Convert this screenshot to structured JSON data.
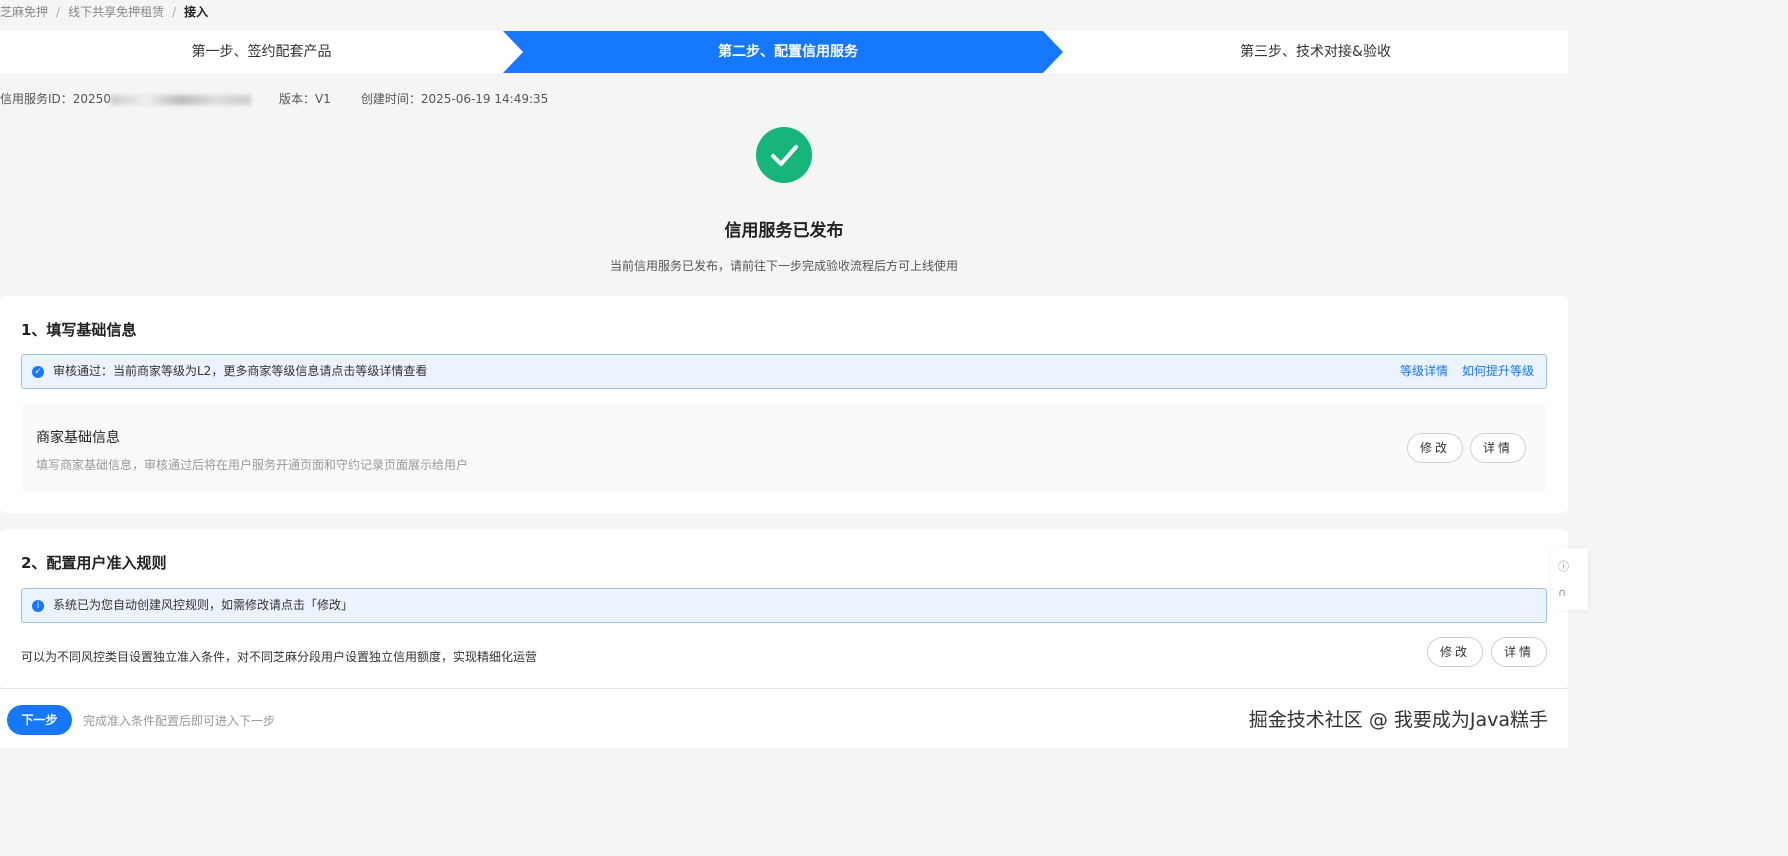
{
  "breadcrumb": [
    "芝麻免押",
    "线下共享免押租赁",
    "接入"
  ],
  "steps": [
    "第一步、签约配套产品",
    "第二步、配置信用服务",
    "第三步、技术对接&验收"
  ],
  "meta": {
    "id_label": "信用服务ID：",
    "id_value": "20250",
    "version": "版本：V1",
    "created": "创建时间：2025-06-19 14:49:35"
  },
  "result": {
    "title": "信用服务已发布",
    "subtitle": "当前信用服务已发布，请前往下一步完成验收流程后方可上线使用"
  },
  "section1": {
    "title": "1、填写基础信息",
    "alert": "审核通过：当前商家等级为L2，更多商家等级信息请点击等级详情查看",
    "link1": "等级详情",
    "link2": "如何提升等级",
    "item_title": "商家基础信息",
    "item_desc": "填写商家基础信息，审核通过后将在用户服务开通页面和守约记录页面展示给用户",
    "edit": "修改",
    "detail": "详情"
  },
  "section2": {
    "title": "2、配置用户准入规则",
    "alert": "系统已为您自动创建风控规则，如需修改请点击「修改」",
    "desc": "可以为不同风控类目设置独立准入条件，对不同芝麻分段用户设置独立信用额度，实现精细化运营",
    "edit": "修改",
    "detail": "详情"
  },
  "footer": {
    "next": "下一步",
    "hint": "完成准入条件配置后即可进入下一步"
  },
  "watermark": "掘金技术社区 @ 我要成为Java糕手",
  "colors": {
    "primary": "#1677ff",
    "success": "#16b57a"
  }
}
